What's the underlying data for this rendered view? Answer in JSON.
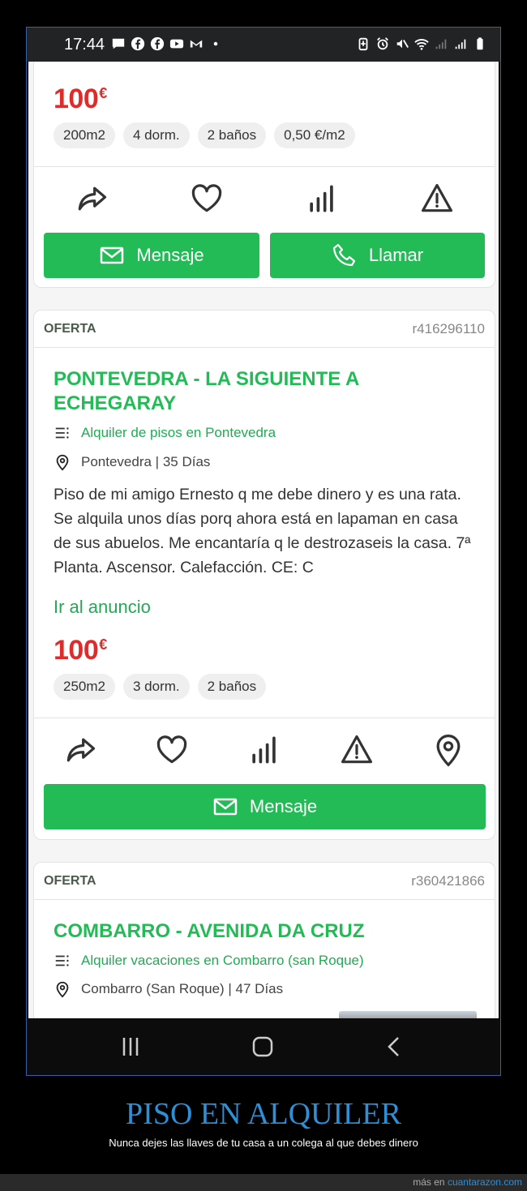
{
  "status_bar": {
    "time": "17:44",
    "left_icons": [
      "message-icon",
      "facebook-icon",
      "facebook-icon",
      "youtube-icon",
      "gmail-icon",
      "dot-icon"
    ],
    "right_icons": [
      "battery-saver-icon",
      "alarm-icon",
      "mute-icon",
      "wifi-icon",
      "signal-icon",
      "signal-r-icon",
      "battery-icon"
    ]
  },
  "listing_top": {
    "price": "100",
    "currency": "€",
    "chips": [
      "200m2",
      "4 dorm.",
      "2 baños",
      "0,50 €/m2"
    ],
    "actions": [
      "share-icon",
      "heart-icon",
      "stats-icon",
      "warning-icon"
    ],
    "message_label": "Mensaje",
    "call_label": "Llamar"
  },
  "listing_pontevedra": {
    "offer_label": "OFERTA",
    "ref": "r416296110",
    "title": "PONTEVEDRA - LA SIGUIENTE A ECHEGARAY",
    "category": "Alquiler de pisos en Pontevedra",
    "location": "Pontevedra | 35 Días",
    "description": "Piso de mi amigo Ernesto q me debe dinero y es una rata. Se alquila unos días porq ahora está en lapaman en casa de sus abuelos. Me encantaría q le destrozaseis la casa. 7ª Planta. Ascensor. Calefacción. CE: C",
    "link_label": "Ir al anuncio",
    "price": "100",
    "currency": "€",
    "chips": [
      "250m2",
      "3 dorm.",
      "2 baños"
    ],
    "actions": [
      "share-icon",
      "heart-icon",
      "stats-icon",
      "warning-icon",
      "location-pin-icon"
    ],
    "message_label": "Mensaje"
  },
  "listing_combarro": {
    "offer_label": "OFERTA",
    "ref": "r360421866",
    "title": "COMBARRO - AVENIDA DA CRUZ",
    "category": "Alquiler vacaciones en Combarro (san Roque)",
    "location": "Combarro (San Roque) | 47 Días"
  },
  "nav_bar": {
    "items": [
      "recent-apps-icon",
      "home-icon",
      "back-icon"
    ]
  },
  "footer": {
    "title": "PISO EN ALQUILER",
    "subtitle": "Nunca dejes las llaves de tu casa a un colega al que debes dinero",
    "more_prefix": "más en",
    "more_brand": "cuantarazon.com"
  },
  "colors": {
    "green": "#22bb55",
    "price_red": "#e02b2b",
    "footer_blue": "#2f8fd6"
  }
}
